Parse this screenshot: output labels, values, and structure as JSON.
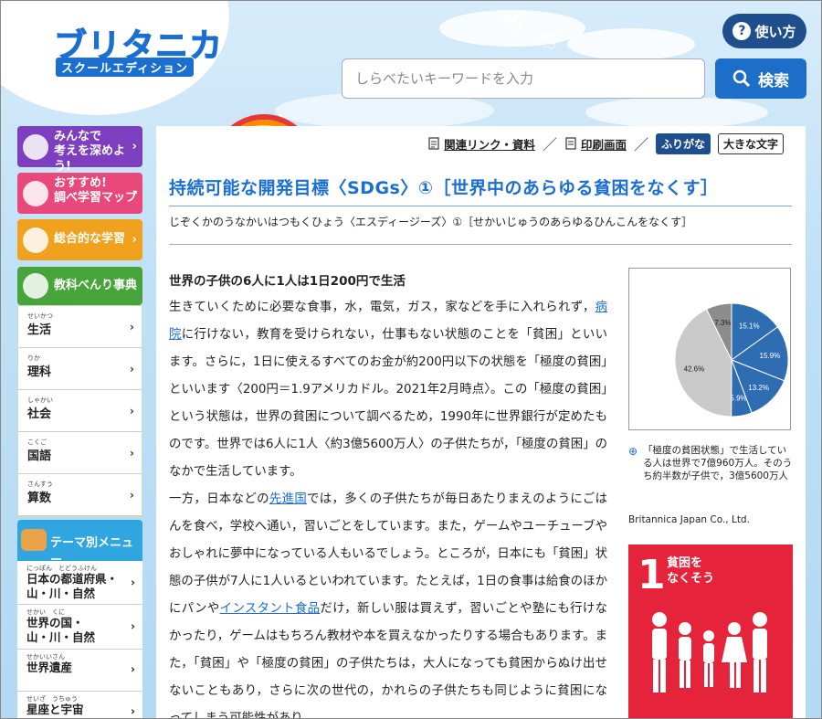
{
  "header": {
    "logo_main": "ブリタニカ",
    "logo_sub": "スクールエディション",
    "help_label": "使い方",
    "search_placeholder": "しらべたいキーワードを入力",
    "search_button": "検索"
  },
  "sidebar": {
    "top_buttons": [
      {
        "line1": "みんなで",
        "line2": "考えを深めよう!"
      },
      {
        "line1": "おすすめ!",
        "line2": "調べ学習マップ"
      },
      {
        "line1": "総合的な学習"
      },
      {
        "line1": "教科べんり事典"
      }
    ],
    "subjects": [
      {
        "ruby": "せいかつ",
        "label": "生活"
      },
      {
        "ruby": "りか",
        "label": "理科"
      },
      {
        "ruby": "しゃかい",
        "label": "社会"
      },
      {
        "ruby": "こくご",
        "label": "国語"
      },
      {
        "ruby": "さんすう",
        "label": "算数"
      }
    ],
    "theme_title": "テーマ別メニュー",
    "theme_items": [
      {
        "ruby": "にっぽん　とどうふけん",
        "line1": "日本の都道府県・",
        "line2": "山・川・自然"
      },
      {
        "ruby": "せかい　くに",
        "line1": "世界の国・",
        "line2": "山・川・自然"
      },
      {
        "ruby": "せかいいさん",
        "line1": "世界遺産",
        "line2": ""
      },
      {
        "ruby": "せいざ　うちゅう",
        "line1": "星座と宇宙",
        "line2": ""
      }
    ]
  },
  "toolbar": {
    "related": "関連リンク・資料",
    "print": "印刷画面",
    "furigana": "ふりがな",
    "large_text": "大きな文字"
  },
  "article": {
    "title": "持続可能な開発目標〈SDGs〉①［世界中のあらゆる貧困をなくす］",
    "title_kana": "じぞくかのうなかいはつもくひょう〈エスディージーズ〉①［せかいじゅうのあらゆるひんこんをなくす］",
    "heading": "世界の子供の6人に1人は1日200円で生活",
    "p1_a": "生きていくために必要な食事，水，電気，ガス，家などを手に入れられず，",
    "p1_link": "病院",
    "p1_b": "に行けない，教育を受けられない，仕事もない状態のことを「貧困」といいます。さらに，1日に使えるすべてのお金が約200円以下の状態を「極度の貧困」といいます〈200円＝1.9アメリカドル。2021年2月時点〉。この「極度の貧困」という状態は，世界の貧困について調べるため，1990年に世界銀行が定めたものです。世界では6人に1人〈約3億5600万人〉の子供たちが，「極度の貧困」のなかで生活しています。",
    "p2_a": "一方，日本などの",
    "p2_link1": "先進国",
    "p2_b": "では，多くの子供たちが毎日あたりまえのようにごはんを食べ，学校へ通い，習いごとをしています。また，ゲームやユーチューブやおしゃれに夢中になっている人もいるでしょう。ところが，日本にも「貧困」状態の子供が7人に1人いるといわれています。たとえば，1日の食事は給食のほかにパンや",
    "p2_link2": "インスタント食品",
    "p2_c": "だけ，新しい服は買えず，習いごとや塾にも行けなかったり，ゲームはもちろん教材や本を買えなかったりする場合もあります。また，「貧困」や「極度の貧困」の子供たちは，大人になっても貧困からぬけ出せないこともあり，さらに次の世代の，かれらの子供たちも同じように貧困になってしまう可能性があり"
  },
  "figure": {
    "caption": "「極度の貧困状態」で生活している人は世界で7億960万人。そのうち約半数が子供で，3億5600万人",
    "credit": "Britannica Japan Co., Ltd.",
    "sdg_number": "1",
    "sdg_label_1": "貧困を",
    "sdg_label_2": "なくそう"
  },
  "chart_data": {
    "type": "pie",
    "title": "",
    "slice_labels": [
      "15.1%",
      "15.9%",
      "13.2%",
      "5.9%",
      "42.6%",
      "7.3%"
    ],
    "values": [
      15.1,
      15.9,
      13.2,
      5.9,
      42.6,
      7.3
    ],
    "colors": [
      "#2f6db3",
      "#2f6db3",
      "#2f6db3",
      "#2f6db3",
      "#c9c9c9",
      "#8c8c8c"
    ]
  }
}
